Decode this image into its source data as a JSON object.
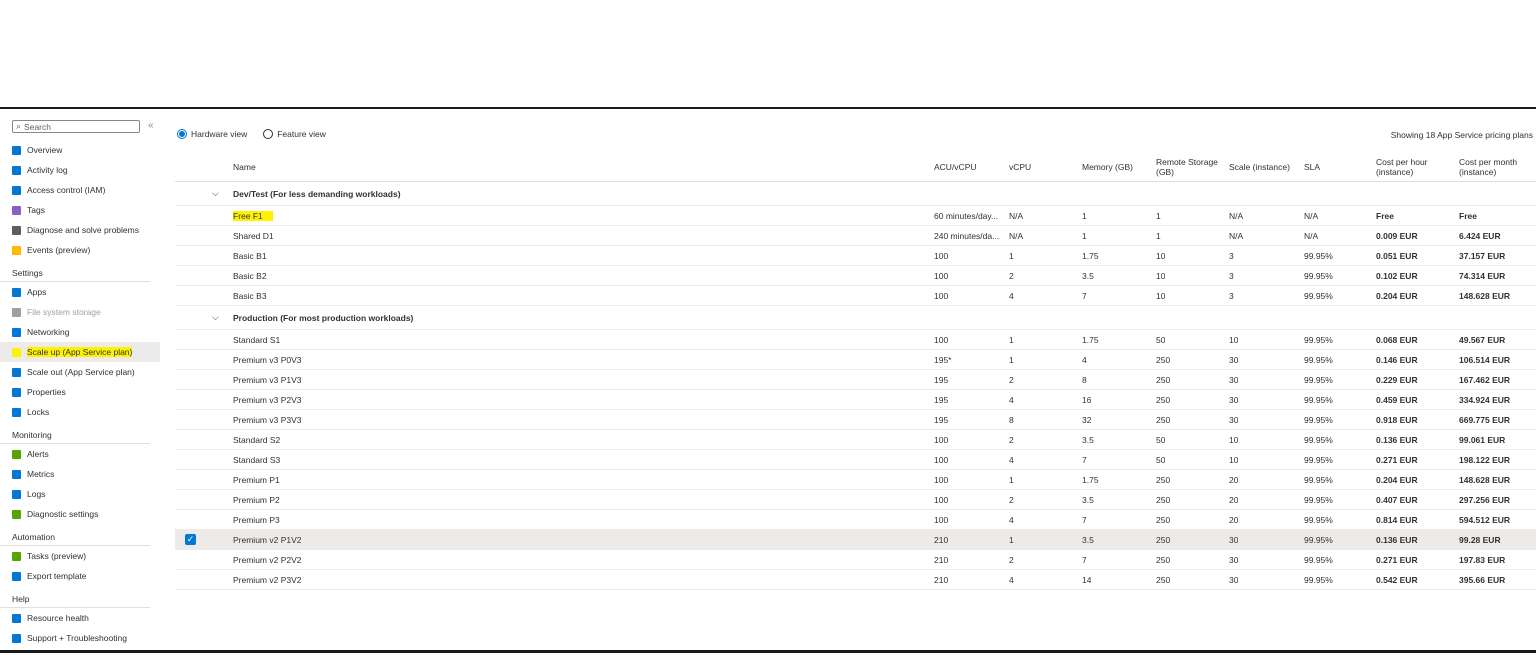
{
  "sidebar": {
    "search_placeholder": "Search",
    "collapse": "«",
    "items": [
      {
        "label": "Overview",
        "icon": "overview-icon",
        "color": "#0078d4"
      },
      {
        "label": "Activity log",
        "icon": "activity-log-icon",
        "color": "#0078d4"
      },
      {
        "label": "Access control (IAM)",
        "icon": "iam-icon",
        "color": "#0078d4"
      },
      {
        "label": "Tags",
        "icon": "tag-icon",
        "color": "#8661c5"
      },
      {
        "label": "Diagnose and solve problems",
        "icon": "wrench-icon",
        "color": "#605e5c"
      },
      {
        "label": "Events (preview)",
        "icon": "lightning-icon",
        "color": "#ffb900"
      }
    ],
    "settings_title": "Settings",
    "settings_items": [
      {
        "label": "Apps",
        "icon": "apps-icon",
        "color": "#0078d4",
        "disabled": false,
        "selected": false
      },
      {
        "label": "File system storage",
        "icon": "storage-icon",
        "color": "#a19f9d",
        "disabled": true,
        "selected": false
      },
      {
        "label": "Networking",
        "icon": "networking-icon",
        "color": "#0078d4",
        "disabled": false,
        "selected": false
      },
      {
        "label": "Scale up (App Service plan)",
        "icon": "scale-up-icon",
        "color": "#fff200",
        "disabled": false,
        "selected": true
      },
      {
        "label": "Scale out (App Service plan)",
        "icon": "scale-out-icon",
        "color": "#0078d4",
        "disabled": false,
        "selected": false
      },
      {
        "label": "Properties",
        "icon": "properties-icon",
        "color": "#0078d4",
        "disabled": false,
        "selected": false
      },
      {
        "label": "Locks",
        "icon": "lock-icon",
        "color": "#0078d4",
        "disabled": false,
        "selected": false
      }
    ],
    "monitoring_title": "Monitoring",
    "monitoring_items": [
      {
        "label": "Alerts",
        "icon": "alerts-icon",
        "color": "#57a300"
      },
      {
        "label": "Metrics",
        "icon": "metrics-icon",
        "color": "#0078d4"
      },
      {
        "label": "Logs",
        "icon": "logs-icon",
        "color": "#0078d4"
      },
      {
        "label": "Diagnostic settings",
        "icon": "diagnostic-settings-icon",
        "color": "#57a300"
      }
    ],
    "automation_title": "Automation",
    "automation_items": [
      {
        "label": "Tasks (preview)",
        "icon": "tasks-icon",
        "color": "#57a300"
      },
      {
        "label": "Export template",
        "icon": "export-template-icon",
        "color": "#0078d4"
      }
    ],
    "help_title": "Help",
    "help_items": [
      {
        "label": "Resource health",
        "icon": "heart-icon",
        "color": "#0078d4"
      },
      {
        "label": "Support + Troubleshooting",
        "icon": "support-icon",
        "color": "#0078d4"
      }
    ]
  },
  "main": {
    "view_hardware": "Hardware view",
    "view_feature": "Feature view",
    "showing": "Showing 18 App Service pricing plans",
    "headers": {
      "name": "Name",
      "acu": "ACU/vCPU",
      "vcpu": "vCPU",
      "memory": "Memory (GB)",
      "remote_storage": "Remote Storage (GB)",
      "scale": "Scale (instance)",
      "sla": "SLA",
      "cost_hour": "Cost per hour (instance)",
      "cost_month": "Cost per month (instance)"
    },
    "groups": [
      {
        "label": "Dev/Test  (For less demanding workloads)",
        "rows": [
          {
            "name": "Free F1",
            "acu": "60 minutes/day...",
            "vcpu": "N/A",
            "memory": "1",
            "storage": "1",
            "scale": "N/A",
            "sla": "N/A",
            "hour": "Free",
            "month": "Free",
            "highlight": true,
            "selected": false
          },
          {
            "name": "Shared D1",
            "acu": "240 minutes/da...",
            "vcpu": "N/A",
            "memory": "1",
            "storage": "1",
            "scale": "N/A",
            "sla": "N/A",
            "hour": "0.009 EUR",
            "month": "6.424 EUR",
            "highlight": false,
            "selected": false
          },
          {
            "name": "Basic B1",
            "acu": "100",
            "vcpu": "1",
            "memory": "1.75",
            "storage": "10",
            "scale": "3",
            "sla": "99.95%",
            "hour": "0.051 EUR",
            "month": "37.157 EUR",
            "highlight": false,
            "selected": false
          },
          {
            "name": "Basic B2",
            "acu": "100",
            "vcpu": "2",
            "memory": "3.5",
            "storage": "10",
            "scale": "3",
            "sla": "99.95%",
            "hour": "0.102 EUR",
            "month": "74.314 EUR",
            "highlight": false,
            "selected": false
          },
          {
            "name": "Basic B3",
            "acu": "100",
            "vcpu": "4",
            "memory": "7",
            "storage": "10",
            "scale": "3",
            "sla": "99.95%",
            "hour": "0.204 EUR",
            "month": "148.628 EUR",
            "highlight": false,
            "selected": false
          }
        ]
      },
      {
        "label": "Production  (For most production workloads)",
        "rows": [
          {
            "name": "Standard S1",
            "acu": "100",
            "vcpu": "1",
            "memory": "1.75",
            "storage": "50",
            "scale": "10",
            "sla": "99.95%",
            "hour": "0.068 EUR",
            "month": "49.567 EUR",
            "highlight": false,
            "selected": false
          },
          {
            "name": "Premium v3 P0V3",
            "acu": "195*",
            "vcpu": "1",
            "memory": "4",
            "storage": "250",
            "scale": "30",
            "sla": "99.95%",
            "hour": "0.146 EUR",
            "month": "106.514 EUR",
            "highlight": false,
            "selected": false
          },
          {
            "name": "Premium v3 P1V3",
            "acu": "195",
            "vcpu": "2",
            "memory": "8",
            "storage": "250",
            "scale": "30",
            "sla": "99.95%",
            "hour": "0.229 EUR",
            "month": "167.462 EUR",
            "highlight": false,
            "selected": false
          },
          {
            "name": "Premium v3 P2V3",
            "acu": "195",
            "vcpu": "4",
            "memory": "16",
            "storage": "250",
            "scale": "30",
            "sla": "99.95%",
            "hour": "0.459 EUR",
            "month": "334.924 EUR",
            "highlight": false,
            "selected": false
          },
          {
            "name": "Premium v3 P3V3",
            "acu": "195",
            "vcpu": "8",
            "memory": "32",
            "storage": "250",
            "scale": "30",
            "sla": "99.95%",
            "hour": "0.918 EUR",
            "month": "669.775 EUR",
            "highlight": false,
            "selected": false
          },
          {
            "name": "Standard S2",
            "acu": "100",
            "vcpu": "2",
            "memory": "3.5",
            "storage": "50",
            "scale": "10",
            "sla": "99.95%",
            "hour": "0.136 EUR",
            "month": "99.061 EUR",
            "highlight": false,
            "selected": false
          },
          {
            "name": "Standard S3",
            "acu": "100",
            "vcpu": "4",
            "memory": "7",
            "storage": "50",
            "scale": "10",
            "sla": "99.95%",
            "hour": "0.271 EUR",
            "month": "198.122 EUR",
            "highlight": false,
            "selected": false
          },
          {
            "name": "Premium P1",
            "acu": "100",
            "vcpu": "1",
            "memory": "1.75",
            "storage": "250",
            "scale": "20",
            "sla": "99.95%",
            "hour": "0.204 EUR",
            "month": "148.628 EUR",
            "highlight": false,
            "selected": false
          },
          {
            "name": "Premium P2",
            "acu": "100",
            "vcpu": "2",
            "memory": "3.5",
            "storage": "250",
            "scale": "20",
            "sla": "99.95%",
            "hour": "0.407 EUR",
            "month": "297.256 EUR",
            "highlight": false,
            "selected": false
          },
          {
            "name": "Premium P3",
            "acu": "100",
            "vcpu": "4",
            "memory": "7",
            "storage": "250",
            "scale": "20",
            "sla": "99.95%",
            "hour": "0.814 EUR",
            "month": "594.512 EUR",
            "highlight": false,
            "selected": false
          },
          {
            "name": "Premium v2 P1V2",
            "acu": "210",
            "vcpu": "1",
            "memory": "3.5",
            "storage": "250",
            "scale": "30",
            "sla": "99.95%",
            "hour": "0.136 EUR",
            "month": "99.28 EUR",
            "highlight": false,
            "selected": true
          },
          {
            "name": "Premium v2 P2V2",
            "acu": "210",
            "vcpu": "2",
            "memory": "7",
            "storage": "250",
            "scale": "30",
            "sla": "99.95%",
            "hour": "0.271 EUR",
            "month": "197.83 EUR",
            "highlight": false,
            "selected": false
          },
          {
            "name": "Premium v2 P3V2",
            "acu": "210",
            "vcpu": "4",
            "memory": "14",
            "storage": "250",
            "scale": "30",
            "sla": "99.95%",
            "hour": "0.542 EUR",
            "month": "395.66 EUR",
            "highlight": false,
            "selected": false
          }
        ]
      }
    ]
  }
}
